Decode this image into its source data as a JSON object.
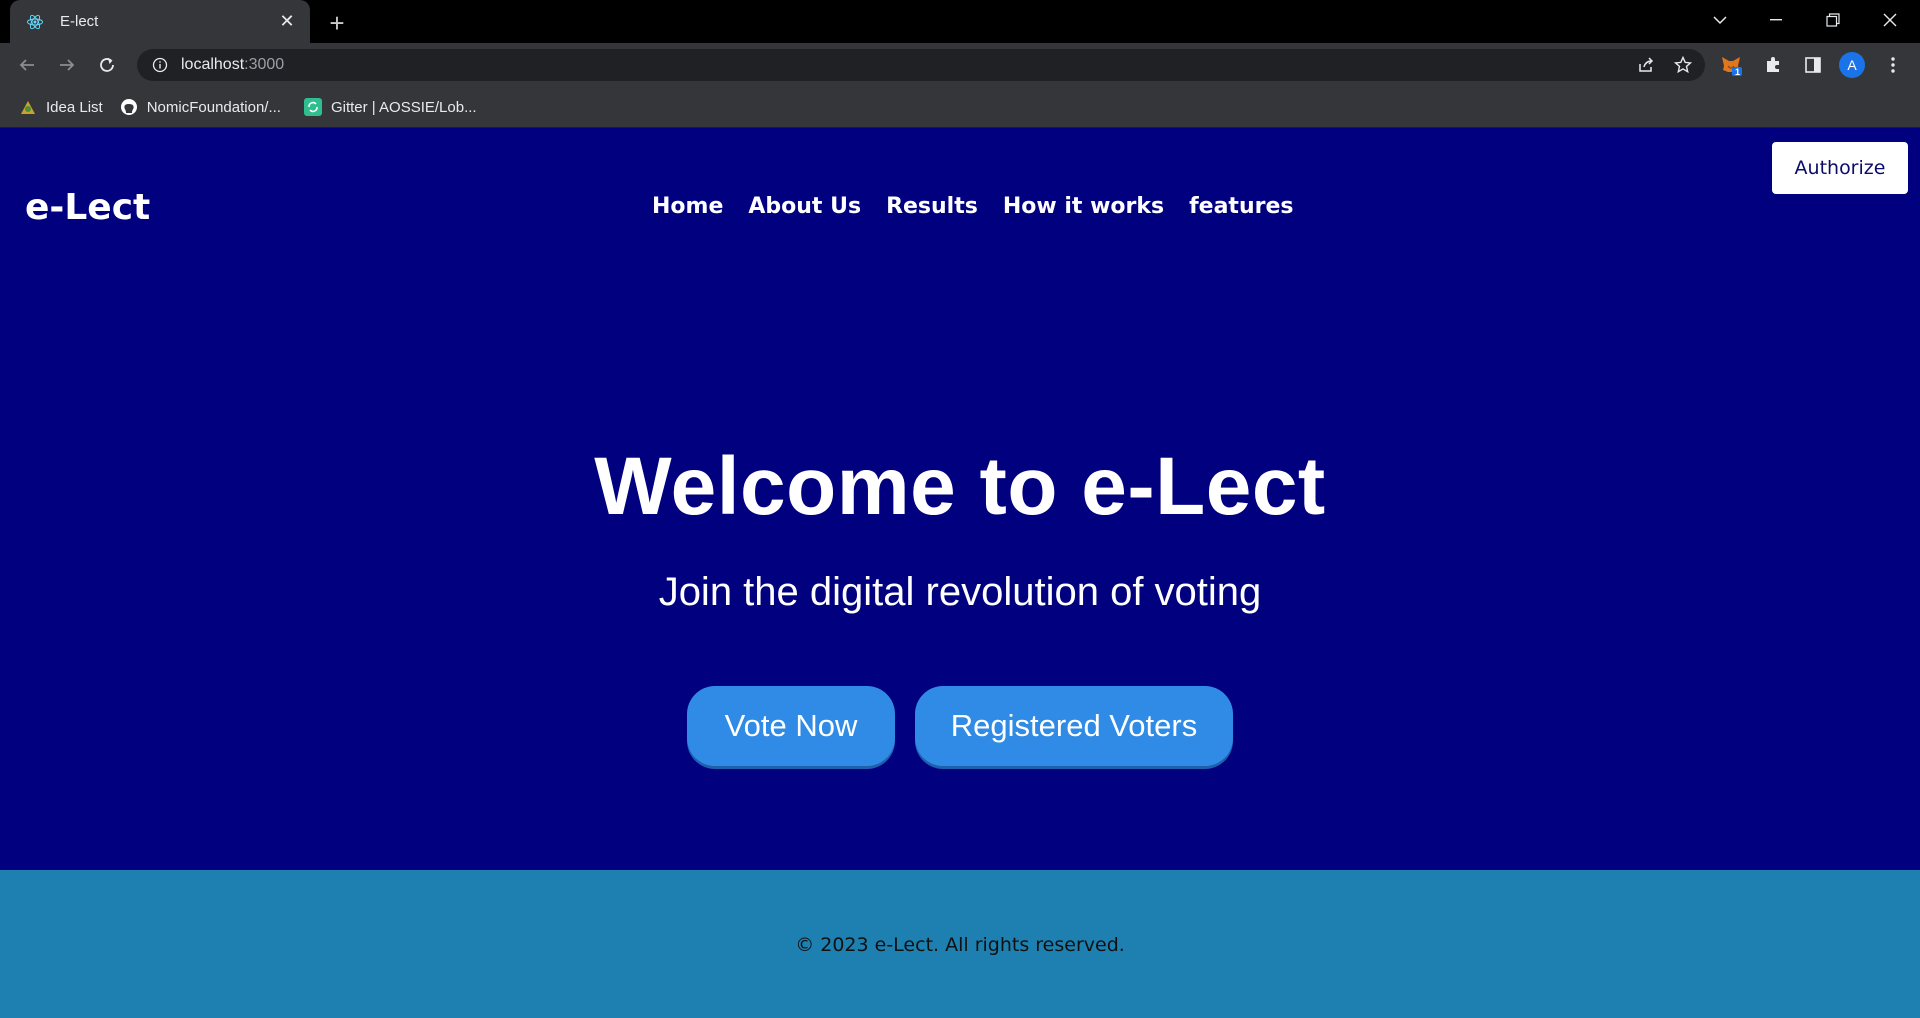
{
  "browser": {
    "tab_title": "E-lect",
    "url_host": "localhost",
    "url_path": ":3000",
    "bookmarks": [
      {
        "label": "Idea List",
        "icon": "idea-list-favicon"
      },
      {
        "label": "NomicFoundation/...",
        "icon": "github-icon"
      },
      {
        "label": "Gitter | AOSSIE/Lob...",
        "icon": "gitter-icon"
      }
    ],
    "profile_initial": "A",
    "extension_badge": "1"
  },
  "header": {
    "brand": "e-Lect",
    "nav": [
      "Home",
      "About Us",
      "Results",
      "How it works",
      "features"
    ],
    "authorize_label": "Authorize"
  },
  "hero": {
    "title": "Welcome to e-Lect",
    "subtitle": "Join the digital revolution of voting",
    "vote_label": "Vote Now",
    "registered_label": "Registered Voters"
  },
  "footer": {
    "copyright": "© 2023 e-Lect. All rights reserved."
  },
  "colors": {
    "hero_bg": "#01017f",
    "footer_bg": "#1e80b0",
    "button_bg": "#2f8be6"
  }
}
